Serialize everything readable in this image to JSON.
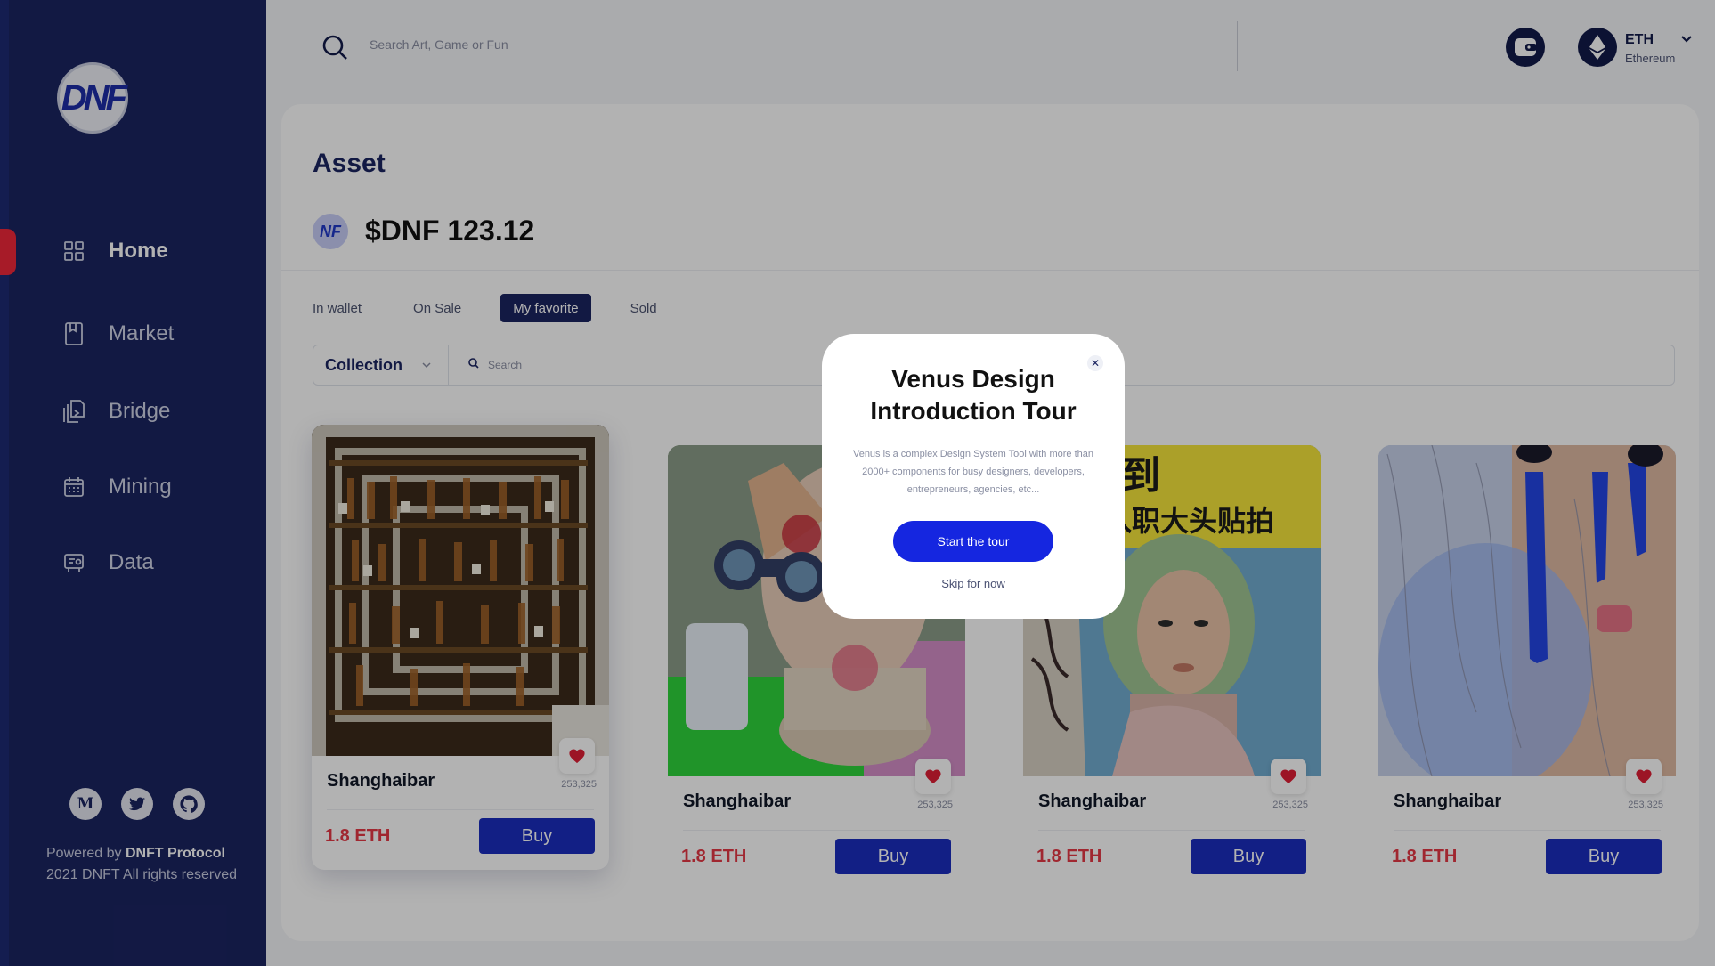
{
  "brand": {
    "logo_text": "DNF"
  },
  "sidebar": {
    "items": [
      {
        "label": "Home",
        "icon": "grid-icon",
        "active": true
      },
      {
        "label": "Market",
        "icon": "bookmark-icon",
        "active": false
      },
      {
        "label": "Bridge",
        "icon": "documents-icon",
        "active": false
      },
      {
        "label": "Mining",
        "icon": "calendar-icon",
        "active": false
      },
      {
        "label": "Data",
        "icon": "report-icon",
        "active": false
      }
    ],
    "socials": [
      {
        "name": "medium",
        "glyph": "M"
      },
      {
        "name": "twitter",
        "glyph": ""
      },
      {
        "name": "github",
        "glyph": ""
      }
    ],
    "footer": {
      "powered_prefix": "Powered by",
      "powered_brand": "DNFT Protocol",
      "copyright": "2021 DNFT All rights reserved"
    }
  },
  "topbar": {
    "search_placeholder": "Search Art, Game or Fun",
    "currency_symbol": "ETH",
    "currency_name": "Ethereum"
  },
  "main": {
    "title": "Asset",
    "coin_label": "NF",
    "balance": "$DNF 123.12",
    "tabs": [
      {
        "label": "In wallet",
        "active": false
      },
      {
        "label": "On Sale",
        "active": false
      },
      {
        "label": "My favorite",
        "active": true
      },
      {
        "label": "Sold",
        "active": false
      }
    ],
    "filter": {
      "collection_label": "Collection",
      "search_placeholder": "Search"
    },
    "cards": [
      {
        "name": "Shanghaibar",
        "count": "253,325",
        "price": "1.8 ETH",
        "buy_label": "Buy",
        "liked": true
      },
      {
        "name": "Shanghaibar",
        "count": "253,325",
        "price": "1.8 ETH",
        "buy_label": "Buy",
        "liked": true
      },
      {
        "name": "Shanghaibar",
        "count": "253,325",
        "price": "1.8 ETH",
        "buy_label": "Buy",
        "liked": true
      },
      {
        "name": "Shanghaibar",
        "count": "253,325",
        "price": "1.8 ETH",
        "buy_label": "Buy",
        "liked": true
      }
    ],
    "card_image_text": {
      "card3_line1": "人!报到",
      "card3_line2": "入职大头贴拍"
    }
  },
  "modal": {
    "title": "Venus Design Introduction Tour",
    "description": "Venus is a complex Design System Tool with more than 2000+ components for busy designers, developers, entrepreneurs, agencies, etc...",
    "start_label": "Start the tour",
    "skip_label": "Skip for now"
  },
  "colors": {
    "sidebar_bg": "#1b2461",
    "accent_blue": "#1b2dbf",
    "price_red": "#e53946",
    "active_indicator": "#f0273a"
  }
}
